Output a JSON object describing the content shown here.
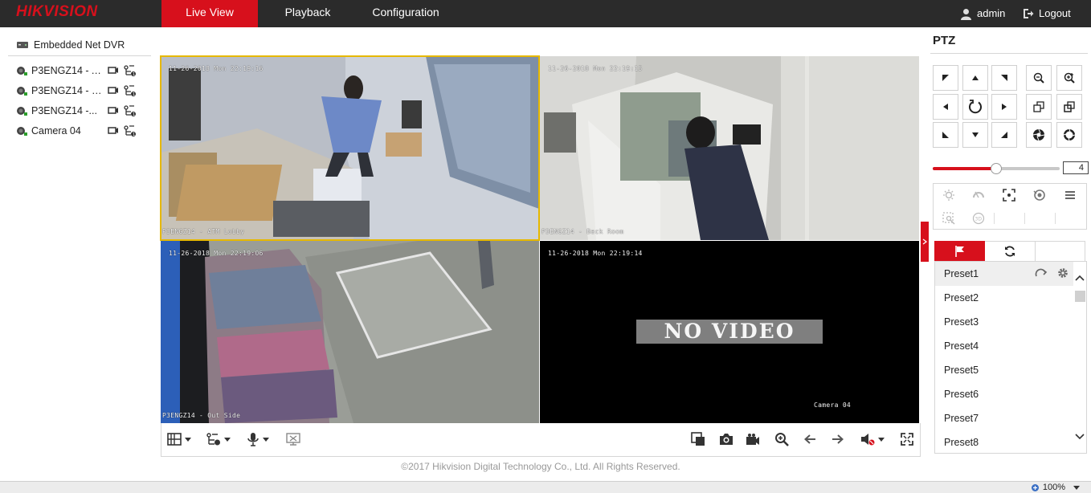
{
  "brand": {
    "logo_text": "HIKVISION"
  },
  "nav": {
    "tabs": [
      {
        "label": "Live View",
        "active": true
      },
      {
        "label": "Playback",
        "active": false
      },
      {
        "label": "Configuration",
        "active": false
      }
    ],
    "user": {
      "label": "admin",
      "icon": "user-icon"
    },
    "logout": {
      "label": "Logout",
      "icon": "logout-icon"
    }
  },
  "device_tree": {
    "root": {
      "label": "Embedded Net DVR",
      "icon": "dvr-icon"
    },
    "cameras": [
      {
        "label": "P3ENGZ14 - A...",
        "icon": "camera-online-icon"
      },
      {
        "label": "P3ENGZ14 - B...",
        "icon": "camera-online-icon"
      },
      {
        "label": "P3ENGZ14 -...",
        "icon": "camera-online-icon"
      },
      {
        "label": "Camera 04",
        "icon": "camera-online-icon"
      }
    ]
  },
  "video": {
    "tiles": [
      {
        "timestamp": "11-26-2018 Mon 22:19:16",
        "caption": "P3ENGZ14 - ATM Lobby",
        "selected": true,
        "no_video": false
      },
      {
        "timestamp": "11-26-2018 Mon 22:19:15",
        "caption": "P3ENGZ14 - Back Room",
        "selected": false,
        "no_video": false
      },
      {
        "timestamp": "11-26-2018 Mon 22:19:06",
        "caption": "P3ENGZ14 - Out Side",
        "selected": false,
        "no_video": false
      },
      {
        "timestamp": "11-26-2018 Mon 22:19:14",
        "caption": "Camera 04",
        "selected": false,
        "no_video": true,
        "no_video_text": "NO VIDEO"
      }
    ]
  },
  "toolbar": {
    "left": [
      "window-layout-icon",
      "stream-type-icon",
      "microphone-icon",
      "digital-zoom-off-icon"
    ],
    "right": [
      "stop-all-icon",
      "capture-icon",
      "record-icon",
      "digital-zoom-icon",
      "previous-page-icon",
      "next-page-icon",
      "audio-muted-icon",
      "fullscreen-icon"
    ]
  },
  "footer": {
    "copyright": "©2017 Hikvision Digital Technology Co., Ltd. All Rights Reserved."
  },
  "ptz": {
    "title": "PTZ",
    "speed": {
      "value": "4",
      "fraction": 0.5
    },
    "presets": [
      "Preset1",
      "Preset2",
      "Preset3",
      "Preset4",
      "Preset5",
      "Preset6",
      "Preset7",
      "Preset8"
    ],
    "highlighted_preset": 0
  },
  "status": {
    "zoom": "100%"
  },
  "colors": {
    "accent": "#d7101c",
    "nav_bg": "#2b2b2b",
    "selected_tile": "#e6b800"
  }
}
